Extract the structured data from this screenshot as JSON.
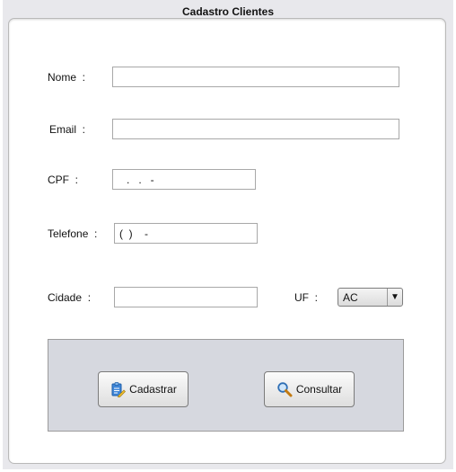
{
  "window": {
    "title": "Cadastro Clientes"
  },
  "form": {
    "nome": {
      "label": "Nome  :",
      "value": ""
    },
    "email": {
      "label": "Email  :",
      "value": ""
    },
    "cpf": {
      "label": "CPF  :",
      "value": "   .   .   -"
    },
    "telefone": {
      "label": "Telefone  :",
      "value": "(  )    -"
    },
    "cidade": {
      "label": "Cidade  :",
      "value": ""
    },
    "uf": {
      "label": "UF  :",
      "selected": "AC"
    }
  },
  "actions": {
    "cadastrar": {
      "label": "Cadastrar",
      "icon": "clipboard-edit-icon"
    },
    "consultar": {
      "label": "Consultar",
      "icon": "search-icon"
    }
  }
}
